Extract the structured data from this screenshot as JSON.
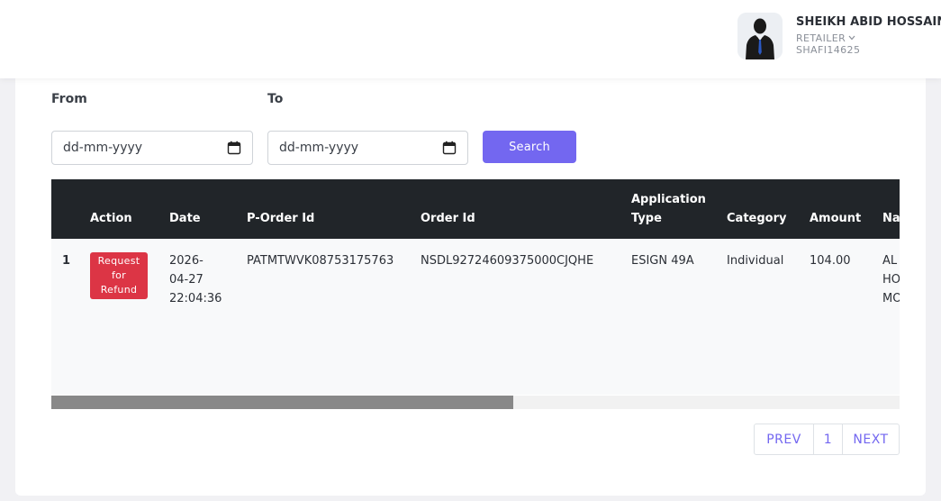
{
  "header": {
    "user_name": "SHEIKH ABID HOSSAIN",
    "user_role": "RETAILER",
    "user_code": "SHAFI14625"
  },
  "filters": {
    "from_label": "From",
    "to_label": "To",
    "from_placeholder": "dd-mm-yyyy",
    "to_placeholder": "dd-mm-yyyy",
    "search_label": "Search"
  },
  "table": {
    "headers": {
      "action": "Action",
      "date": "Date",
      "porder": "P-Order Id",
      "order": "Order Id",
      "app_type_1": "Application",
      "app_type_2": "Type",
      "category": "Category",
      "amount": "Amount",
      "name": "Na"
    },
    "rows": [
      {
        "index": "1",
        "action_1": "Request",
        "action_2": "for",
        "action_3": "Refund",
        "date_1": "2026-",
        "date_2": "04-27",
        "date_3": "22:04:36",
        "porder": "PATMTWVK08753175763",
        "order": "NSDL92724609375000CJQHE",
        "app_type": "ESIGN 49A",
        "category": "Individual",
        "amount": "104.00",
        "name_1": "AL",
        "name_2": "HO",
        "name_3": "MO"
      }
    ],
    "scroll_fraction": 0.545
  },
  "pagination": {
    "prev": "PREV",
    "page": "1",
    "next": "NEXT"
  },
  "colors": {
    "accent": "#7367f0",
    "danger": "#dc3545",
    "table_head": "#212529"
  }
}
